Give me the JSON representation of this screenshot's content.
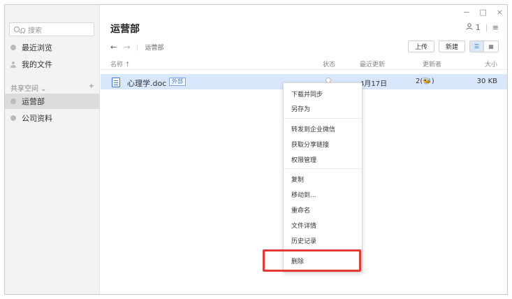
{
  "sidebar": {
    "search_placeholder": "Q 搜索",
    "items": [
      {
        "label": "最近浏览"
      },
      {
        "label": "我的文件"
      }
    ],
    "section": {
      "label": "共享空间 ⌄",
      "add": "+"
    },
    "spaces": [
      {
        "label": "运营部"
      },
      {
        "label": "公司资料"
      }
    ]
  },
  "window_controls": {
    "minimize": "−",
    "maximize": "□",
    "close": "×"
  },
  "header": {
    "title": "运营部",
    "member_count": "1",
    "menu_icon": "≡",
    "user_icon": "person-icon"
  },
  "nav": {
    "back": "←",
    "forward": "→",
    "breadcrumb": "运营部"
  },
  "toolbar": {
    "upload": "上传",
    "new": "新建",
    "list_view": "☰",
    "grid_view": "▦"
  },
  "table": {
    "headers": {
      "name": "名称 ↑",
      "status": "状态",
      "updated": "最近更新",
      "updater": "更新者",
      "size": "大小"
    },
    "rows": [
      {
        "name": "心理学.doc",
        "tag": "外部",
        "updated": "4月17日",
        "updater": "2(🐝)",
        "size": "30 KB"
      }
    ]
  },
  "context_menu": {
    "items": [
      "下载并同步",
      "另存为",
      "转发到企业微信",
      "获取分享链接",
      "权限管理",
      "复制",
      "移动到...",
      "重命名",
      "文件详情",
      "历史记录",
      "删除"
    ]
  },
  "colors": {
    "selection": "#d8e7fb",
    "accent": "#3d7ad8",
    "highlight_box": "#e53935"
  }
}
